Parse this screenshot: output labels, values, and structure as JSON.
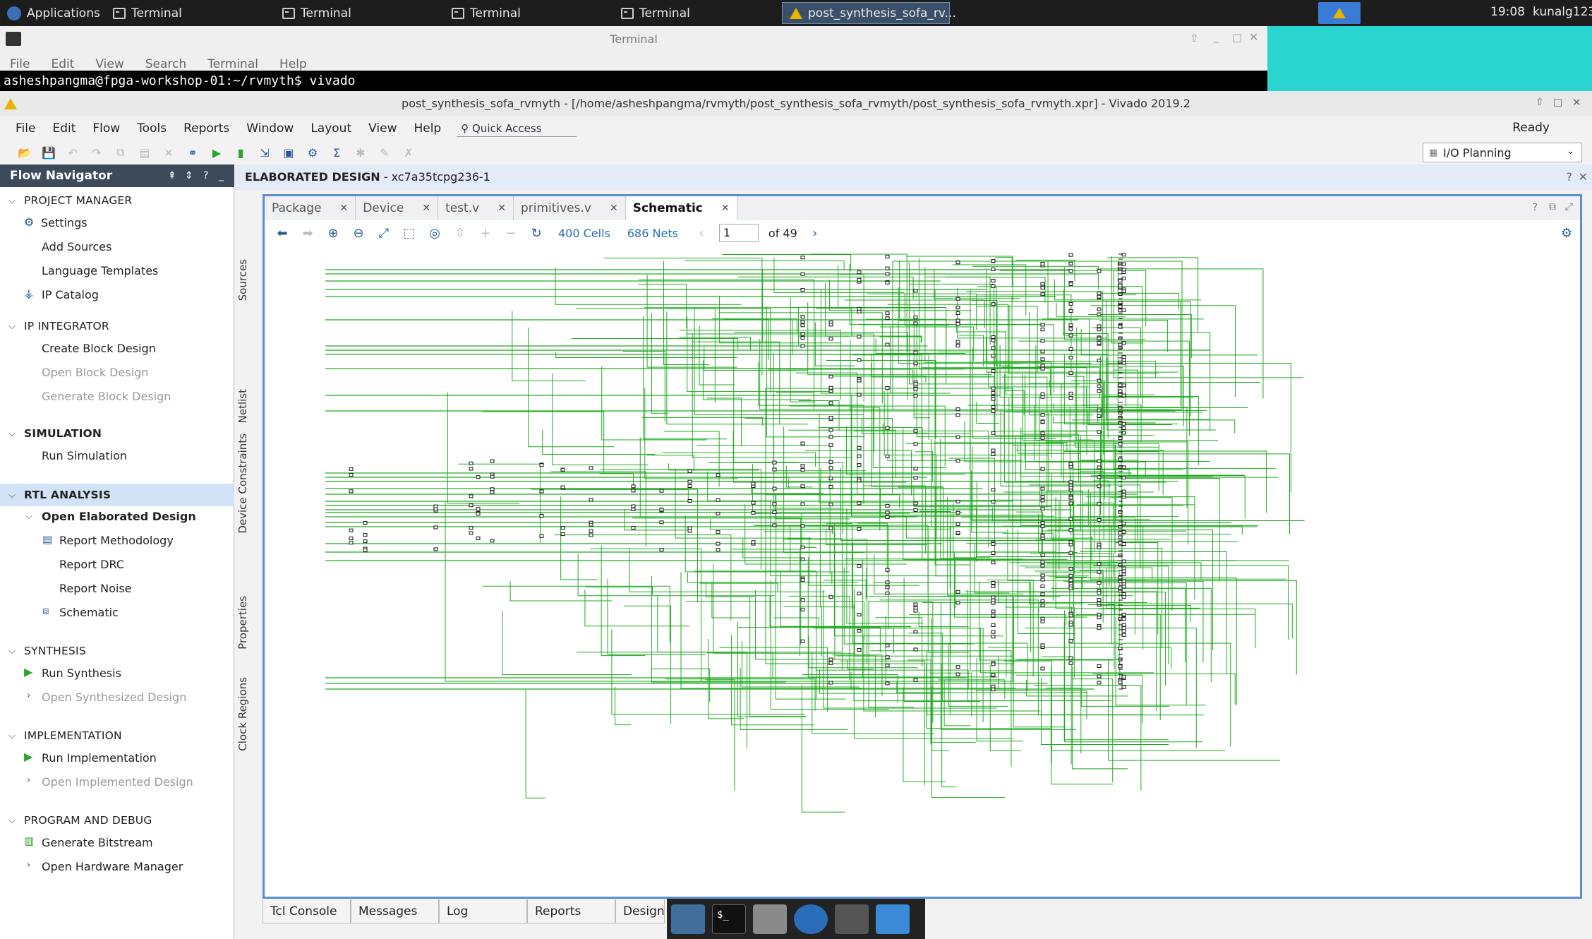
{
  "taskbar": {
    "apps_label": "Applications",
    "items": [
      "Terminal",
      "Terminal",
      "Terminal",
      "Terminal",
      "post_synthesis_sofa_rv..."
    ],
    "clock": "19:08",
    "user": "kunalg123"
  },
  "terminal": {
    "title": "Terminal",
    "menu": [
      "File",
      "Edit",
      "View",
      "Search",
      "Terminal",
      "Help"
    ],
    "prompt": "asheshpangma@fpga-workshop-01:~/rvmyth$ vivado"
  },
  "vivado": {
    "title": "post_synthesis_sofa_rvmyth - [/home/asheshpangma/rvmyth/post_synthesis_sofa_rvmyth/post_synthesis_sofa_rvmyth.xpr] - Vivado 2019.2",
    "menu": [
      "File",
      "Edit",
      "Flow",
      "Tools",
      "Reports",
      "Window",
      "Layout",
      "View",
      "Help"
    ],
    "quick_access": "Quick Access",
    "status": "Ready",
    "layout": "I/O Planning",
    "colors": {
      "accent": "#5b8ed2",
      "nav_header": "#3c4a5a",
      "wire": "#22aa22",
      "highlight": "#d3e3f7"
    }
  },
  "flow_navigator": {
    "title": "Flow Navigator",
    "project_manager": "PROJECT MANAGER",
    "settings": "Settings",
    "add_sources": "Add Sources",
    "language_templates": "Language Templates",
    "ip_catalog": "IP Catalog",
    "ip_integrator": "IP INTEGRATOR",
    "create_block": "Create Block Design",
    "open_block": "Open Block Design",
    "generate_block": "Generate Block Design",
    "simulation": "SIMULATION",
    "run_simulation": "Run Simulation",
    "rtl_analysis": "RTL ANALYSIS",
    "open_elaborated": "Open Elaborated Design",
    "report_methodology": "Report Methodology",
    "report_drc": "Report DRC",
    "report_noise": "Report Noise",
    "schematic": "Schematic",
    "synthesis": "SYNTHESIS",
    "run_synthesis": "Run Synthesis",
    "open_synth": "Open Synthesized Design",
    "implementation": "IMPLEMENTATION",
    "run_impl": "Run Implementation",
    "open_impl": "Open Implemented Design",
    "program_debug": "PROGRAM AND DEBUG",
    "gen_bitstream": "Generate Bitstream",
    "open_hw": "Open Hardware Manager"
  },
  "design": {
    "header_bold": "ELABORATED DESIGN",
    "header_part": " - xc7a35tcpg236-1",
    "side_tabs": [
      "Sources",
      "Netlist",
      "Device Constraints",
      "Properties",
      "Clock Regions"
    ],
    "tabs": [
      "Package",
      "Device",
      "test.v",
      "primitives.v",
      "Schematic"
    ],
    "cells": "400 Cells",
    "nets": "686 Nets",
    "page": "1",
    "page_of": "of 49",
    "bottom_tabs": [
      "Tcl Console",
      "Messages",
      "Log",
      "Reports",
      "Design"
    ]
  }
}
